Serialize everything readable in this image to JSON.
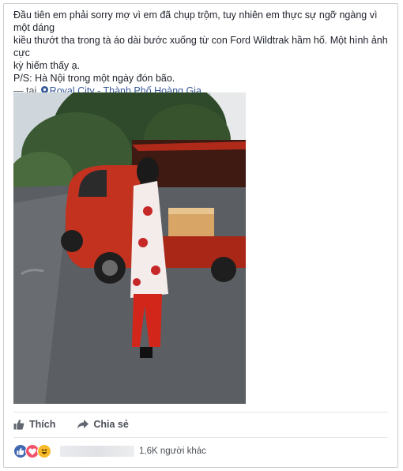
{
  "post": {
    "line1": "Đầu tiên em phải sorry mợ vì em đã chụp trộm, tuy nhiên em thực sự ngỡ ngàng vì một dáng",
    "line2": "kiều thướt tha trong tà áo dài bước xuống từ con Ford Wildtrak hầm hố. Một hình ảnh cực",
    "line3": "kỳ hiếm thấy ạ.",
    "ps": "P/S: Hà Nội trong một ngày đón bão.",
    "location_prefix": "— tại",
    "location_name": "Royal City - Thành Phố Hoàng Gia."
  },
  "photo": {
    "icon": "photo-of-woman-in-ao-dai-beside-red-ford-pickup"
  },
  "actions": {
    "like_label": "Thích",
    "share_label": "Chia sẻ"
  },
  "reactions": {
    "icons": [
      "like-icon",
      "love-icon",
      "haha-icon"
    ],
    "count_text": "1,6K người khác"
  },
  "colors": {
    "link": "#365899",
    "like_blue": "#4267b2",
    "love_red": "#f25268",
    "haha_yellow": "#f7b928",
    "truck_red": "#c2321f"
  }
}
